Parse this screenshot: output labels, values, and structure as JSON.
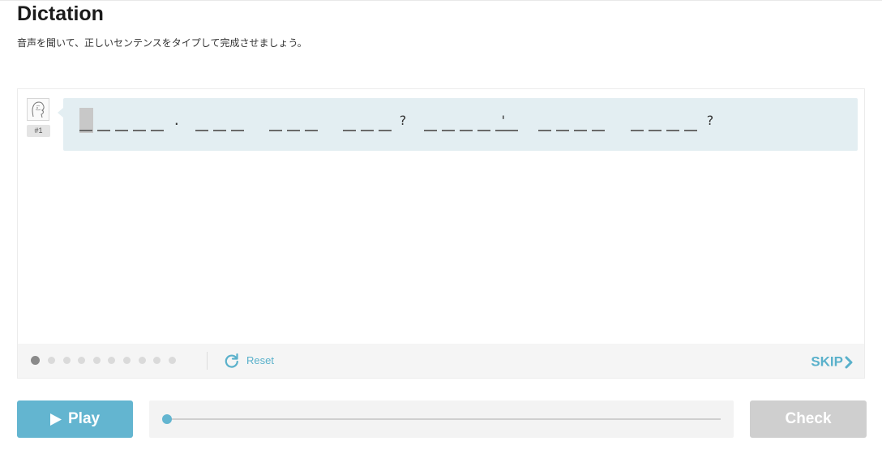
{
  "header": {
    "title": "Dictation",
    "subtitle": "音声を聞いて、正しいセンテンスをタイプして完成させましょう。"
  },
  "question": {
    "number_label": "#1",
    "avatar_icon": "person-sketch-icon",
    "punctuation": [
      ".",
      "?",
      "'",
      "?"
    ]
  },
  "progress": {
    "total_dots": 10,
    "current_index": 0
  },
  "footer": {
    "reset_label": "Reset",
    "reset_icon": "refresh-icon",
    "skip_label": "SKIP",
    "skip_icon": "chevron-right-icon"
  },
  "controls": {
    "play_label": "Play",
    "play_icon": "play-icon",
    "check_label": "Check",
    "audio_progress": 0
  },
  "colors": {
    "accent": "#63b5d0",
    "bubble_bg": "#e3eef2",
    "check_disabled": "#cfcfcf"
  }
}
